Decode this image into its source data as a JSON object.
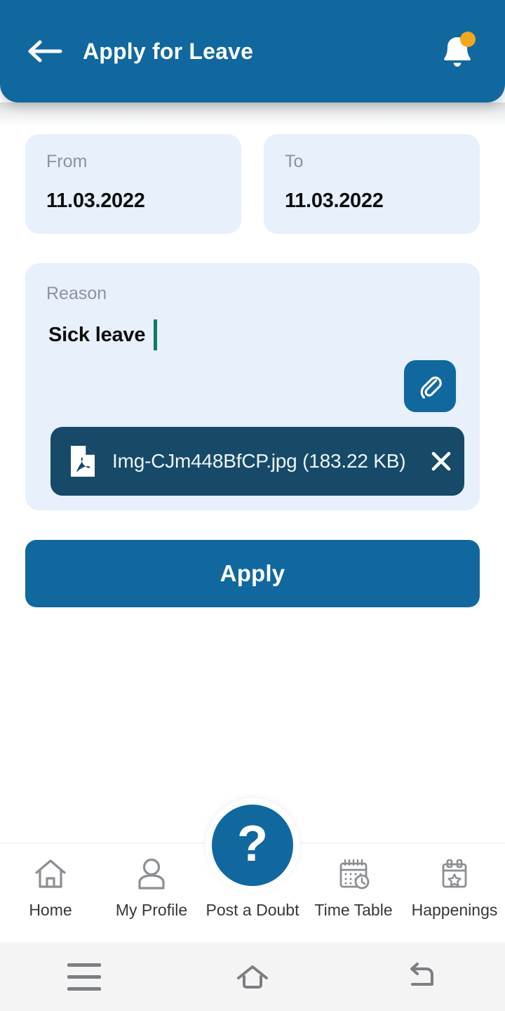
{
  "header": {
    "title": "Apply for Leave",
    "back_icon": "arrow-left-icon",
    "bell_icon": "bell-icon",
    "has_notification_badge": true,
    "background_color": "#11689f",
    "badge_color": "#f0a81e"
  },
  "form": {
    "from": {
      "label": "From",
      "value": "11.03.2022"
    },
    "to": {
      "label": "To",
      "value": "11.03.2022"
    },
    "reason": {
      "label": "Reason",
      "value": "Sick leave",
      "caret_color": "#0f7a66",
      "attach_icon": "paperclip-icon"
    },
    "attachment": {
      "file_icon": "pdf-file-icon",
      "name": "Img-CJm448BfCP.jpg (183.22 KB)",
      "close_icon": "close-icon",
      "background_color": "#174a68"
    },
    "submit_label": "Apply",
    "card_color": "#e7f0fb"
  },
  "bottom_nav": {
    "items": [
      {
        "label": "Home",
        "icon": "home-icon"
      },
      {
        "label": "My Profile",
        "icon": "person-icon"
      },
      {
        "label": "Post a Doubt",
        "icon": "question-mark-icon"
      },
      {
        "label": "Time Table",
        "icon": "calendar-clock-icon"
      },
      {
        "label": "Happenings",
        "icon": "calendar-star-icon"
      }
    ],
    "fab_glyph": "?"
  },
  "system_nav": {
    "recents_icon": "menu-icon",
    "home_icon": "home-outline-icon",
    "back_icon": "back-arrow-icon"
  }
}
